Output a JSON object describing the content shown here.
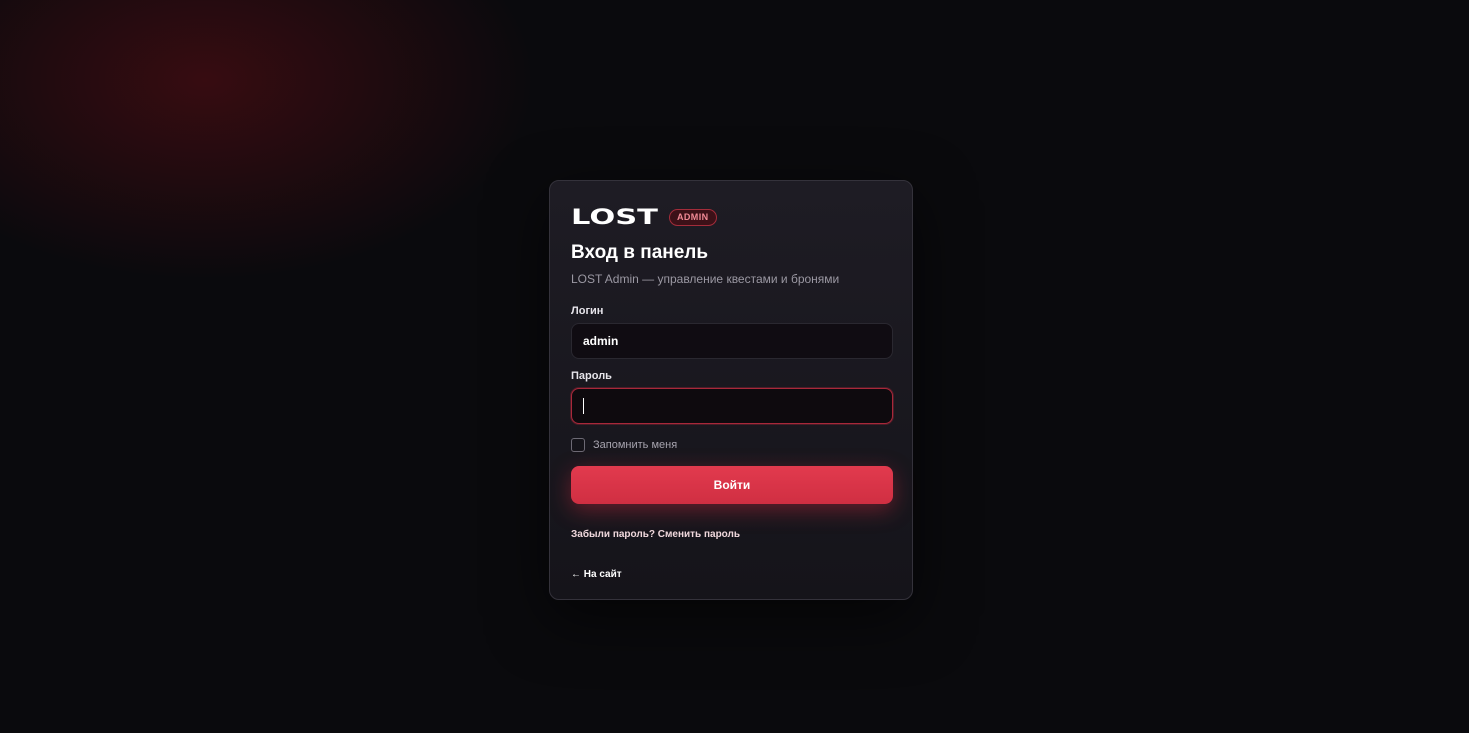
{
  "brand": {
    "logo": "LOST",
    "badge": "ADMIN"
  },
  "login_form": {
    "title": "Вход в панель",
    "subtitle": "LOST Admin — управление квестами и бронями",
    "login_label": "Логин",
    "login_value": "admin",
    "password_label": "Пароль",
    "password_value": "",
    "remember_label": "Запомнить меня",
    "remember_checked": false,
    "submit_label": "Войти",
    "forgot_link": "Забыли пароль? Сменить пароль",
    "back_link": "← На сайт"
  },
  "colors": {
    "background": "#0a0a0d",
    "card": "#1b1a21",
    "accent": "#dc3548",
    "badge_border": "#a32c3a"
  }
}
